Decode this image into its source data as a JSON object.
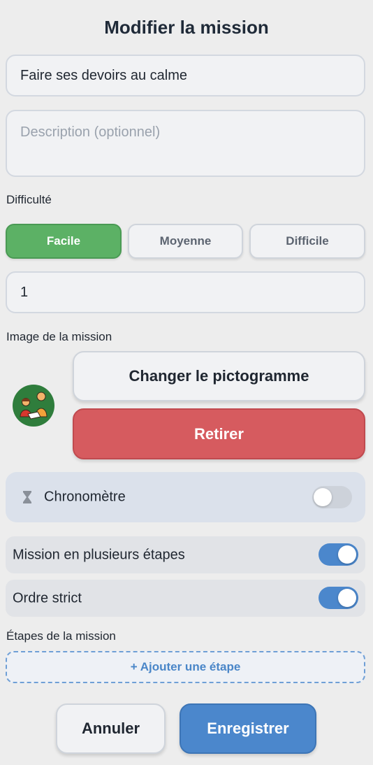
{
  "header": {
    "title": "Modifier la mission"
  },
  "form": {
    "name_value": "Faire ses devoirs au calme",
    "description_placeholder": "Description (optionnel)",
    "difficulty_label": "Difficulté",
    "difficulty_options": [
      "Facile",
      "Moyenne",
      "Difficile"
    ],
    "difficulty_selected": "Facile",
    "points_value": "1",
    "image_label": "Image de la mission",
    "image_icon": "children-reading-pictogram",
    "change_pictogram_label": "Changer le pictogramme",
    "remove_label": "Retirer"
  },
  "options": {
    "timer_label": "Chronomètre",
    "timer_icon": "hourglass-icon",
    "timer_enabled": false,
    "multi_step_label": "Mission en plusieurs étapes",
    "multi_step_enabled": true,
    "strict_order_label": "Ordre strict",
    "strict_order_enabled": true
  },
  "steps": {
    "label": "Étapes de la mission",
    "add_step_label": "+ Ajouter une étape"
  },
  "footer": {
    "cancel_label": "Annuler",
    "save_label": "Enregistrer"
  },
  "colors": {
    "primary": "#4b87cc",
    "success": "#5cb165",
    "danger": "#d65b5f"
  }
}
